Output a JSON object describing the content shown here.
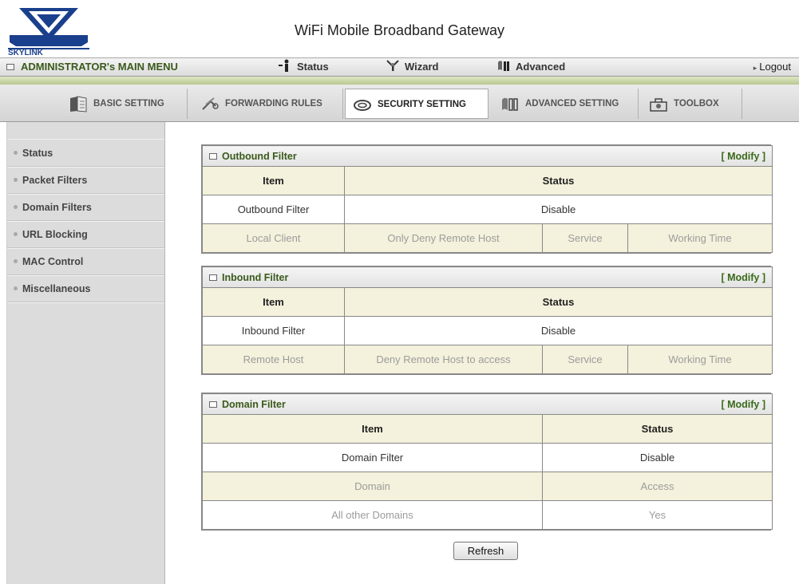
{
  "header": {
    "title": "WiFi Mobile Broadband Gateway",
    "logo_text": "SKYLINK"
  },
  "menu": {
    "admin_label": "ADMINISTRATOR's MAIN MENU",
    "status": "Status",
    "wizard": "Wizard",
    "advanced": "Advanced",
    "logout": "Logout",
    "logout_arrow": "▸"
  },
  "tabs": {
    "basic": "BASIC SETTING",
    "forwarding": "FORWARDING RULES",
    "security": "SECURITY SETTING",
    "advanced": "ADVANCED SETTING",
    "toolbox": "TOOLBOX"
  },
  "sidebar": {
    "items": [
      {
        "label": "Status"
      },
      {
        "label": "Packet Filters"
      },
      {
        "label": "Domain Filters"
      },
      {
        "label": "URL Blocking"
      },
      {
        "label": "MAC Control"
      },
      {
        "label": "Miscellaneous"
      }
    ]
  },
  "outbound": {
    "title": "Outbound Filter",
    "modify": "[ Modify ]",
    "col_item": "Item",
    "col_status": "Status",
    "row_item": "Outbound Filter",
    "row_status": "Disable",
    "sub": [
      "Local Client",
      "Only Deny Remote Host",
      "Service",
      "Working Time"
    ]
  },
  "inbound": {
    "title": "Inbound Filter",
    "modify": "[ Modify ]",
    "col_item": "Item",
    "col_status": "Status",
    "row_item": "Inbound Filter",
    "row_status": "Disable",
    "sub": [
      "Remote Host",
      "Deny Remote Host to access",
      "Service",
      "Working Time"
    ]
  },
  "domain": {
    "title": "Domain Filter",
    "modify": "[ Modify ]",
    "col_item": "Item",
    "col_status": "Status",
    "row_item": "Domain Filter",
    "row_status": "Disable",
    "sub_domain": "Domain",
    "sub_access": "Access",
    "other_domains": "All other Domains",
    "other_access": "Yes"
  },
  "refresh_label": "Refresh",
  "colors": {
    "accent_green": "#3a5a1a",
    "header_row": "#f4f1dc",
    "logo_blue": "#1a3f8c"
  }
}
